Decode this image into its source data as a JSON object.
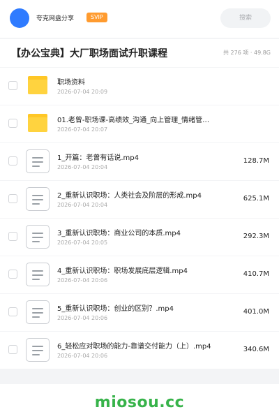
{
  "header": {
    "account_name": "夸克网盘分享",
    "vip_label": "SVIP",
    "search_placeholder": "搜索"
  },
  "folder": {
    "title": "【办公宝典】大厂职场面试升职课程",
    "meta": "共 276 项 · 49.8G"
  },
  "files": [
    {
      "type": "folder",
      "name": "职场资料",
      "date": "2026-07-04 20:09",
      "size": ""
    },
    {
      "type": "folder",
      "name": "01.老曾-职场课-高绩效_沟通_向上管理_情绪管…",
      "date": "2026-07-04 20:07",
      "size": ""
    },
    {
      "type": "doc",
      "name": "1_开篇：老曾有话说.mp4",
      "date": "2026-07-04 20:04",
      "size": "128.7M"
    },
    {
      "type": "doc",
      "name": "2_重新认识职场：人类社会及阶层的形成.mp4",
      "date": "2026-07-04 20:04",
      "size": "625.1M"
    },
    {
      "type": "doc",
      "name": "3_重新认识职场：商业公司的本质.mp4",
      "date": "2026-07-04 20:05",
      "size": "292.3M"
    },
    {
      "type": "doc",
      "name": "4_重新认识职场：职场发展底层逻辑.mp4",
      "date": "2026-07-04 20:06",
      "size": "410.7M"
    },
    {
      "type": "doc",
      "name": "5_重新认识职场：创业的区别？.mp4",
      "date": "2026-07-04 20:06",
      "size": "401.0M"
    },
    {
      "type": "doc",
      "name": "6_轻松应对职场的能力-靠谱交付能力（上）.mp4",
      "date": "2026-07-04 20:06",
      "size": "340.6M"
    }
  ],
  "watermark": "miosou.cc",
  "colors": {
    "accent": "#2f7bff",
    "vip": "#ff9b2f",
    "folder": "#ffd33f",
    "watermark": "#37b34a"
  }
}
